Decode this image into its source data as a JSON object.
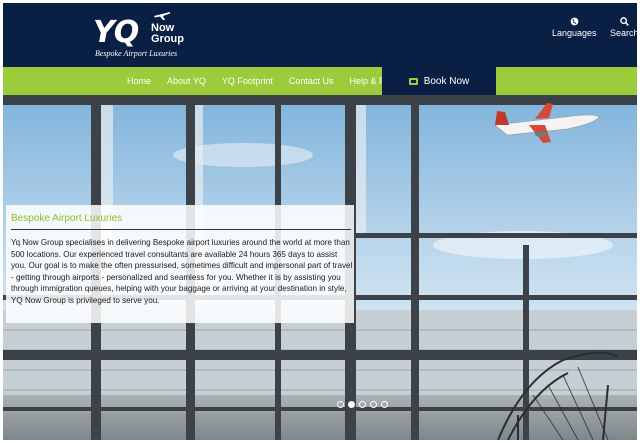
{
  "header": {
    "logo": {
      "brand": "YQ",
      "brand_sub_1": "Now",
      "brand_sub_2": "Group",
      "tagline": "Bespoke Airport Luxuries"
    },
    "tools": [
      {
        "label": "Languages",
        "icon": "globe-icon"
      },
      {
        "label": "Search",
        "icon": "search-icon"
      }
    ]
  },
  "nav": {
    "links": [
      "Home",
      "About YQ",
      "YQ Footprint",
      "Contact Us",
      "Help & FAQs"
    ],
    "book_label": "Book Now",
    "book_icon": "ticket-icon"
  },
  "hero": {
    "title": "Bespoke Airport Luxuries",
    "body": "Yq Now Group specialises in delivering Bespoke airport luxuries around the world at more than 500 locations. Our experienced travel consultants are available 24 hours 365 days to assist you. Our goal is to make the often pressurised, sometimes difficult and impersonal part of travel - getting through airports - personalized and seamless for you. Whether it is by assisting you through immigration queues, helping with your baggage or arriving at your destination in style, YQ Now Group is privileged to serve you.",
    "slides": 5,
    "active_slide": 2
  },
  "colors": {
    "navy": "#0a1f44",
    "green": "#9ccb3b",
    "title_green": "#8dbf2e"
  }
}
